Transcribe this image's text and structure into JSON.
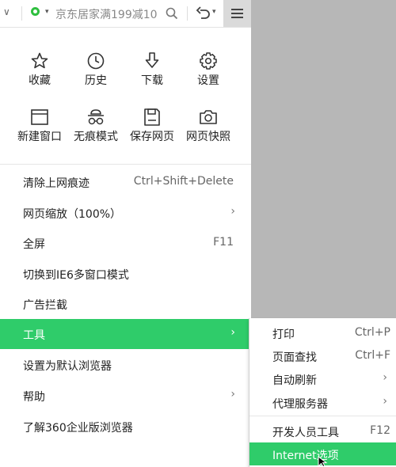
{
  "toolbar": {
    "search_text": "京东居家满199减10",
    "back_chevron": "∨",
    "logo_caret": "▾",
    "undo_caret": "▾"
  },
  "quick_actions_row1": [
    {
      "icon": "star-icon",
      "label": "收藏"
    },
    {
      "icon": "clock-icon",
      "label": "历史"
    },
    {
      "icon": "download-icon",
      "label": "下载"
    },
    {
      "icon": "gear-icon",
      "label": "设置"
    }
  ],
  "quick_actions_row2": [
    {
      "icon": "window-icon",
      "label": "新建窗口"
    },
    {
      "icon": "incognito-icon",
      "label": "无痕模式"
    },
    {
      "icon": "save-icon",
      "label": "保存网页"
    },
    {
      "icon": "camera-icon",
      "label": "网页快照"
    }
  ],
  "menu_items": [
    {
      "label": "清除上网痕迹",
      "shortcut": "Ctrl+Shift+Delete",
      "arrow": ""
    },
    {
      "label": "网页缩放（100%）",
      "shortcut": "",
      "arrow": "›"
    },
    {
      "label": "全屏",
      "shortcut": "F11",
      "arrow": ""
    },
    {
      "label": "切换到IE6多窗口模式",
      "shortcut": "",
      "arrow": ""
    },
    {
      "label": "广告拦截",
      "shortcut": "",
      "arrow": ""
    },
    {
      "label": "工具",
      "shortcut": "",
      "arrow": "›"
    },
    {
      "label": "设置为默认浏览器",
      "shortcut": "",
      "arrow": ""
    },
    {
      "label": "帮助",
      "shortcut": "",
      "arrow": "›"
    },
    {
      "label": "了解360企业版浏览器",
      "shortcut": "",
      "arrow": ""
    }
  ],
  "submenu_items": [
    {
      "label": "打印",
      "shortcut": "Ctrl+P",
      "arrow": ""
    },
    {
      "label": "页面查找",
      "shortcut": "Ctrl+F",
      "arrow": ""
    },
    {
      "label": "自动刷新",
      "shortcut": "",
      "arrow": "›"
    },
    {
      "label": "代理服务器",
      "shortcut": "",
      "arrow": "›"
    },
    {
      "label": "开发人员工具",
      "shortcut": "F12",
      "arrow": ""
    },
    {
      "label": "Internet选项",
      "shortcut": "",
      "arrow": ""
    }
  ],
  "colors": {
    "accent": "#2fcc6a",
    "logo": "#2fbf3f",
    "backdrop": "#b7b7b7"
  }
}
